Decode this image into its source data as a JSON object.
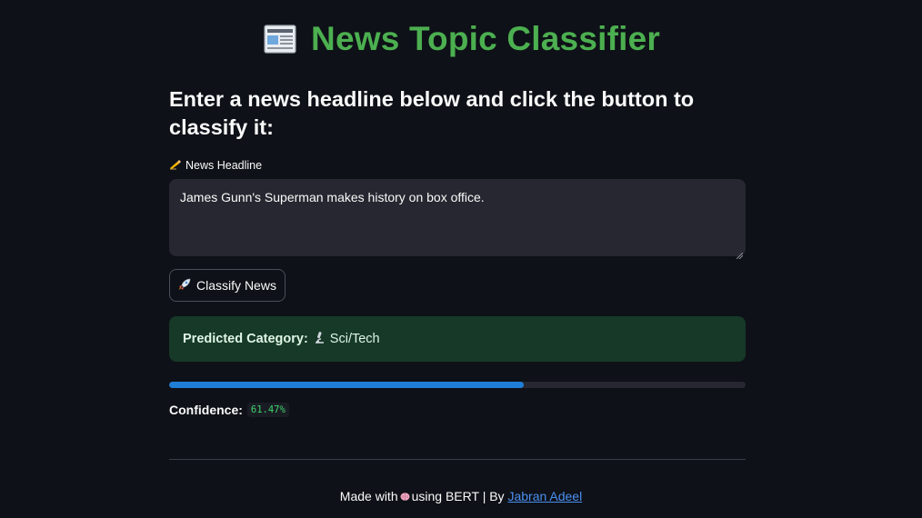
{
  "header": {
    "icon": "newspaper-icon",
    "title": "News Topic Classifier"
  },
  "main": {
    "instructions": "Enter a news headline below and click the button to classify it:",
    "headline_field": {
      "label_icon": "writing-hand-icon",
      "label": "News Headline",
      "value": "James Gunn's Superman makes history on box office."
    },
    "classify_button": {
      "icon": "rocket-icon",
      "label": "Classify News"
    },
    "result": {
      "label": "Predicted Category:",
      "category_icon": "microscope-icon",
      "category": "Sci/Tech"
    },
    "confidence": {
      "progress_fraction": 0.6147,
      "label": "Confidence:",
      "value": "61.47%"
    }
  },
  "footer": {
    "text_before": "Made with",
    "icon": "brain-icon",
    "text_after": "using BERT | By",
    "link_text": "Jabran Adeel"
  },
  "colors": {
    "background": "#0e1117",
    "title": "#4caf50",
    "input_bg": "#262730",
    "success_bg": "#173928",
    "progress_fill": "#1f7fd6",
    "confidence_text": "#3dd56d",
    "link": "#4a8ff0"
  }
}
